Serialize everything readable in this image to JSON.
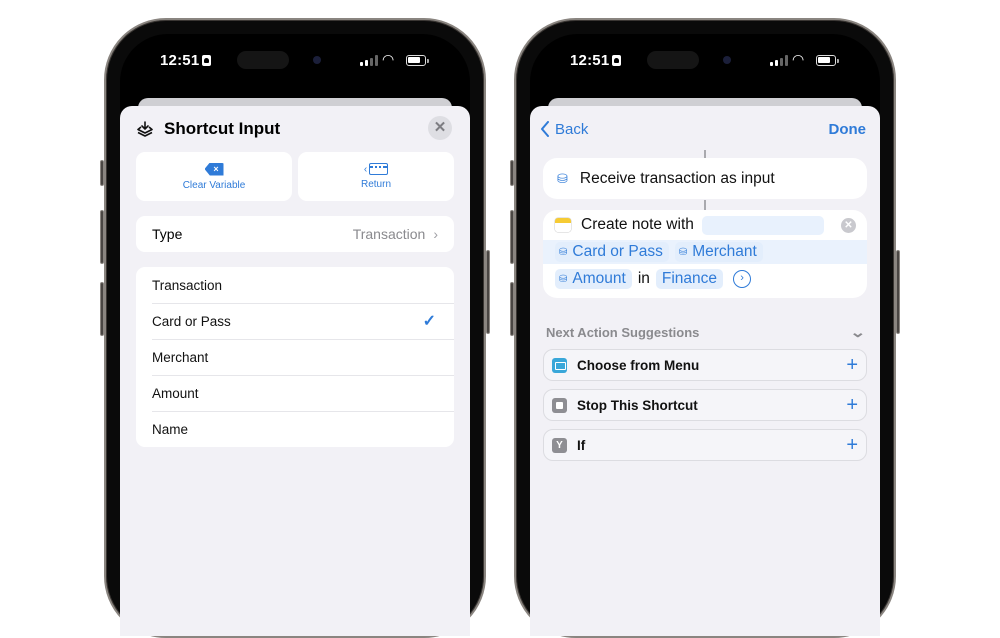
{
  "left_phone": {
    "status_bar": {
      "time": "12:51"
    },
    "sheet": {
      "title": "Shortcut Input",
      "title_icon": "shortcut-input-icon",
      "close_icon": "close-icon",
      "buttons": [
        {
          "label": "Clear Variable",
          "icon": "clear-variable-icon"
        },
        {
          "label": "Return",
          "icon": "keyboard-return-icon"
        }
      ],
      "type_row": {
        "label": "Type",
        "value": "Transaction",
        "chevron": "›"
      },
      "options": [
        {
          "label": "Transaction",
          "selected": false
        },
        {
          "label": "Card or Pass",
          "selected": true
        },
        {
          "label": "Merchant",
          "selected": false
        },
        {
          "label": "Amount",
          "selected": false
        },
        {
          "label": "Name",
          "selected": false
        }
      ],
      "check_glyph": "✓"
    }
  },
  "right_phone": {
    "status_bar": {
      "time": "12:51"
    },
    "nav": {
      "back_label": "Back",
      "done_label": "Done"
    },
    "actions": {
      "receive": {
        "text": "Receive transaction as input"
      },
      "create_note": {
        "prefix": "Create note with",
        "tokens": [
          "Card or Pass",
          "Merchant",
          "Amount"
        ],
        "in_word": "in",
        "folder": "Finance"
      }
    },
    "suggestions": {
      "header": "Next Action Suggestions",
      "items": [
        {
          "label": "Choose from Menu",
          "icon": "choose-from-menu-icon"
        },
        {
          "label": "Stop This Shortcut",
          "icon": "stop-icon"
        },
        {
          "label": "If",
          "icon": "if-icon"
        }
      ],
      "add_glyph": "+"
    }
  },
  "colors": {
    "accent": "#2f7bd8",
    "sheet_bg": "#f2f1f6",
    "card_bg": "#ffffff",
    "token_bg": "#e3eefc"
  }
}
